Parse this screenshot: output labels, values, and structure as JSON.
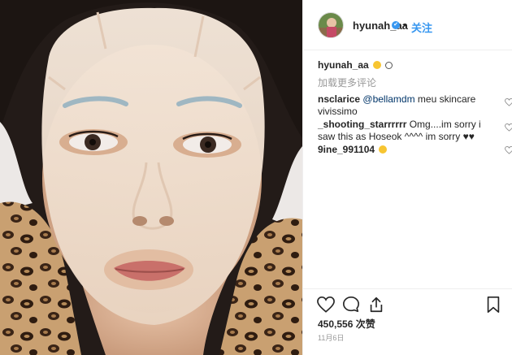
{
  "post": {
    "username": "hyunah_aa",
    "verified_badge": "✔",
    "separator": "•",
    "follow_label": "关注"
  },
  "caption": {
    "username": "hyunah_aa",
    "emoji_icons": [
      "slightly-frowning-face-icon",
      "smiling-face-icon"
    ]
  },
  "load_more_label": "加载更多评论",
  "comments": [
    {
      "username": "nsclarice",
      "mention": "@bellamdm",
      "text": " meu skincare vivissimo"
    },
    {
      "username": "_shooting_starrrrrr",
      "text": " Omg....im sorry i saw this as Hoseok ^^^^ im sorry ♥♥"
    },
    {
      "username": "9ine_991104",
      "emoji_icon": "heart-eyes-face-icon"
    }
  ],
  "likes": "450,556 次赞",
  "date": "11月6日",
  "icons": {
    "like": "heart-outline-icon",
    "comment": "speech-bubble-icon",
    "share": "share-upload-icon",
    "save": "bookmark-icon"
  },
  "colors": {
    "link_blue": "#3897f0",
    "mention_blue": "#003569",
    "muted_gray": "#999999",
    "text": "#262626"
  }
}
